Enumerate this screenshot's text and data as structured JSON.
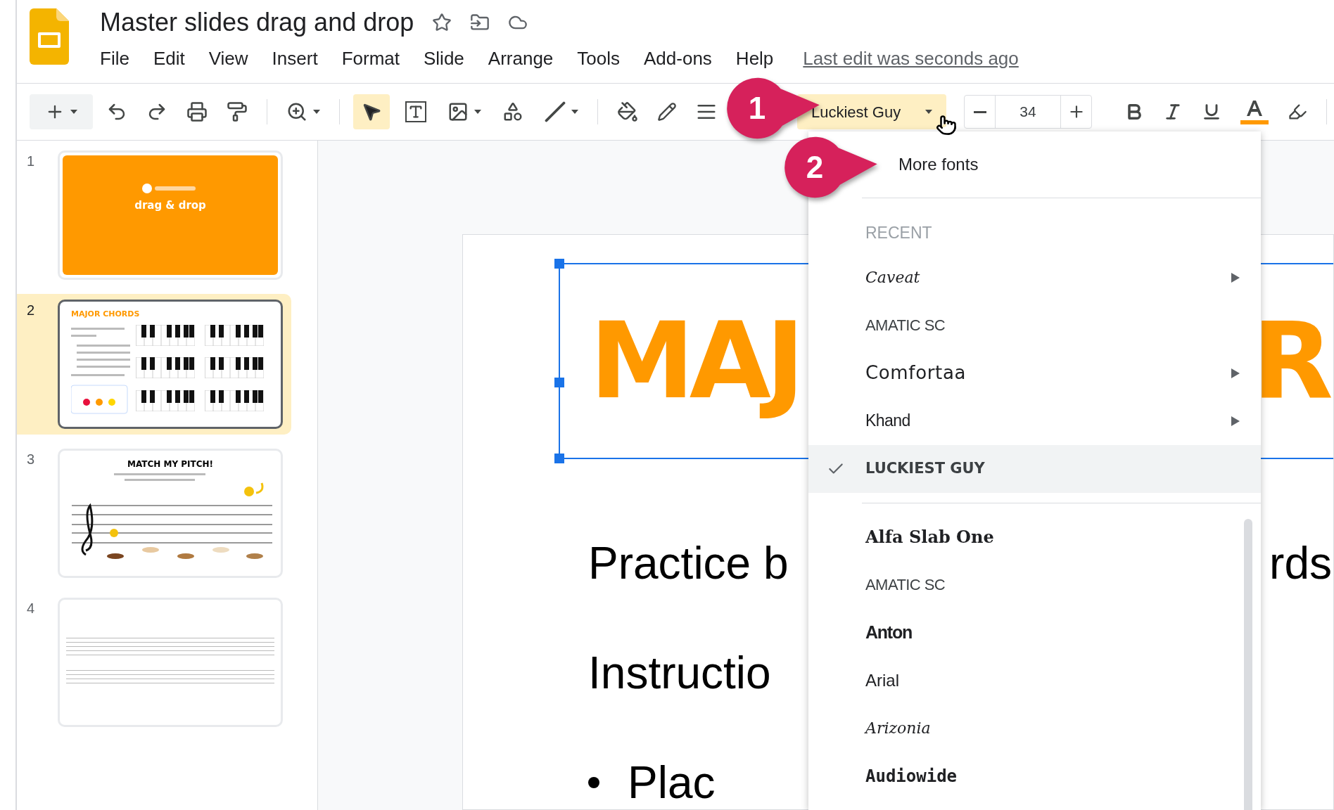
{
  "app": {
    "title": "Master slides drag and drop",
    "menu": [
      "File",
      "Edit",
      "View",
      "Insert",
      "Format",
      "Slide",
      "Arrange",
      "Tools",
      "Add-ons",
      "Help"
    ],
    "last_edit": "Last edit was seconds ago"
  },
  "toolbar": {
    "modes": [
      {
        "kind": "select",
        "selected": true
      },
      {
        "kind": "textbox",
        "selected": false
      },
      {
        "kind": "image",
        "selected": false
      },
      {
        "kind": "shape",
        "selected": false
      },
      {
        "kind": "line",
        "selected": false
      }
    ],
    "font_button": {
      "label": "Luckiest Guy",
      "open": true
    },
    "font_size": "34"
  },
  "callouts": [
    "1",
    "2"
  ],
  "slides": [
    {
      "number": "1",
      "selected": false,
      "kind": "title",
      "title": "drag & drop"
    },
    {
      "number": "2",
      "selected": true,
      "kind": "chords",
      "title": "MAJOR CHORDS"
    },
    {
      "number": "3",
      "selected": false,
      "kind": "pitch",
      "title": "MATCH MY PITCH!"
    },
    {
      "number": "4",
      "selected": false,
      "kind": "staff"
    }
  ],
  "canvas": {
    "title_left": "MAJ",
    "title_right": "R",
    "lines": [
      {
        "left": "Practice b",
        "right": "rds",
        "bullet": false
      },
      {
        "left": "Instructio",
        "bullet": false
      },
      {
        "left": "Plac",
        "bullet": true
      }
    ]
  },
  "font_menu": {
    "more": "More fonts",
    "recent_label": "RECENT",
    "recent": [
      {
        "label": "Caveat",
        "kind": "script",
        "submenu": true,
        "selected": false
      },
      {
        "label": "AMATIC SC",
        "kind": "condensed",
        "submenu": false,
        "selected": false
      },
      {
        "label": "Comfortaa",
        "kind": "rounded",
        "submenu": true,
        "selected": false
      },
      {
        "label": "Khand",
        "kind": "narrow",
        "submenu": true,
        "selected": false
      },
      {
        "label": "LUCKIEST GUY",
        "kind": "display",
        "submenu": false,
        "selected": true
      }
    ],
    "all": [
      {
        "label": "Alfa Slab One",
        "kind": "slab",
        "submenu": false,
        "selected": false
      },
      {
        "label": "AMATIC SC",
        "kind": "condensed",
        "submenu": false,
        "selected": false
      },
      {
        "label": "Anton",
        "kind": "heavy",
        "submenu": false,
        "selected": false
      },
      {
        "label": "Arial",
        "kind": "sans",
        "submenu": false,
        "selected": false
      },
      {
        "label": "Arizonia",
        "kind": "script",
        "submenu": false,
        "selected": false
      },
      {
        "label": "Audiowide",
        "kind": "tech",
        "submenu": false,
        "selected": false
      }
    ]
  }
}
